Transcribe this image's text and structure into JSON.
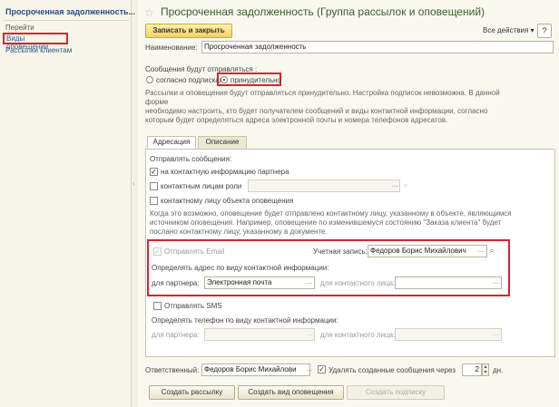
{
  "sidebar": {
    "title": "Просроченная задолженность...",
    "goto": "Перейти",
    "items": [
      {
        "label": "Виды оповещений"
      },
      {
        "label": "Рассылки клиентам"
      }
    ]
  },
  "header": {
    "title": "Просроченная задолженность (Группа рассылок и оповещений)",
    "save_close": "Записать и закрыть",
    "all_actions": "Все действия ▾",
    "help": "?"
  },
  "form": {
    "name_label": "Наименование:",
    "name_value": "Просроченная задолженность",
    "send_label": "Сообщения будут отправляться :",
    "radio_subscribers": "согласно подпискам",
    "radio_forced": "принудительно",
    "desc_lines": [
      "Рассылки и оповещения будут отправляться принудительно. Настройка подписок невозможна. В данной",
      "форме",
      "необходимо настроить, кто будет получателем сообщений и виды контактной информации, согласно",
      "которым будет определяться адреса электронной почты и номера телефонов адресатов."
    ]
  },
  "tabs": [
    {
      "label": "Адресация"
    },
    {
      "label": "Описание"
    }
  ],
  "addressing": {
    "send_to_label": "Отправлять сообщения:",
    "cb_partner_ci": "на контактную информацию партнера",
    "cb_contact_role": "контактным лицам роли",
    "cb_object_contact": "контактному лицу объекта оповещения",
    "info_lines": [
      "Когда это возможно, оповещение будет отправлено контактному лицу, указанному в объекте, являющимся",
      "источником оповещения. Например, оповещение по изменившемуся состоянию \"Заказа клиента\" будет",
      "послано контактному лицу, указанному в документе."
    ],
    "cb_send_email": "Отправлять Email",
    "account_label": "Учетная запись:",
    "account_value": "Федоров Борис Михайлович",
    "email_ci_label": "Определять адрес по виду контактной информации:",
    "for_partner_label": "для партнера:",
    "for_partner_value": "Электронная почта",
    "for_contact_label": "для контактного лица:",
    "for_contact_value": "",
    "cb_send_sms": "Отправлять SMS",
    "phone_ci_label": "Определять телефон по виду контактной информации:",
    "sms_partner_label": "для партнера:",
    "sms_contact_label": "для контактного лица:"
  },
  "footer": {
    "responsible_label": "Ответственный:",
    "responsible_value": "Федоров Борис Михайлови",
    "delete_label": "Удалять созданные сообщения через",
    "days_value": "2",
    "days_unit": "дн.",
    "btn_create_mailing": "Создать рассылку",
    "btn_create_alert_type": "Создать вид оповещения",
    "btn_create_subscription": "Создать подписку"
  },
  "colors": {
    "accent_red": "#d9232b",
    "primary_button": "#f4d15a",
    "link_blue": "#2e5a8c"
  }
}
